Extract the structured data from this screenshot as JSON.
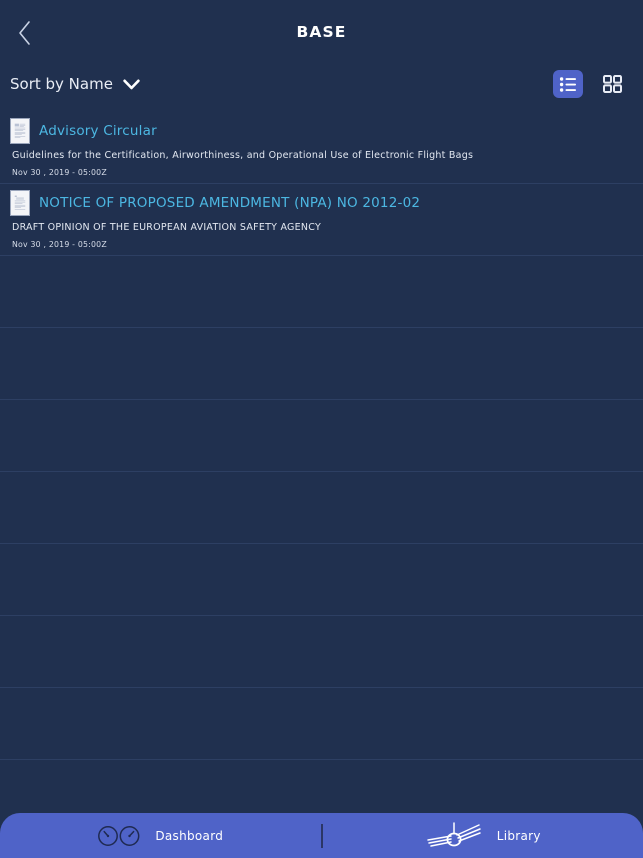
{
  "app": {
    "background_color": "#20304f",
    "accent_color": "#4f63c8",
    "link_color": "#4cb7e2",
    "divider_color": "#2d3f63"
  },
  "header": {
    "title": "BASE",
    "back_icon": "chevron-left-icon"
  },
  "toolbar": {
    "sort_label": "Sort by Name",
    "sort_chevron_icon": "chevron-down-icon",
    "views": [
      {
        "name": "list-view",
        "icon": "list-view-icon",
        "active": true
      },
      {
        "name": "grid-view",
        "icon": "grid-view-icon",
        "active": false
      }
    ]
  },
  "list": {
    "empty_row_count": 8,
    "items": [
      {
        "thumbnail_icon": "document-page-icon",
        "title": "Advisory Circular",
        "description": "Guidelines for the Certification, Airworthiness, and Operational Use of Electronic Flight Bags",
        "date": "Nov 30 , 2019 - 05:00Z"
      },
      {
        "thumbnail_icon": "document-page-icon",
        "title": "NOTICE OF PROPOSED AMENDMENT (NPA) NO 2012-02",
        "description": "DRAFT OPINION OF THE EUROPEAN AVIATION SAFETY AGENCY",
        "date": "Nov 30 , 2019 - 05:00Z"
      }
    ]
  },
  "bottom_nav": {
    "items": [
      {
        "name": "dashboard",
        "label": "Dashboard",
        "icon": "dual-gauge-icon"
      },
      {
        "name": "library",
        "label": "Library",
        "icon": "open-book-icon"
      }
    ]
  }
}
